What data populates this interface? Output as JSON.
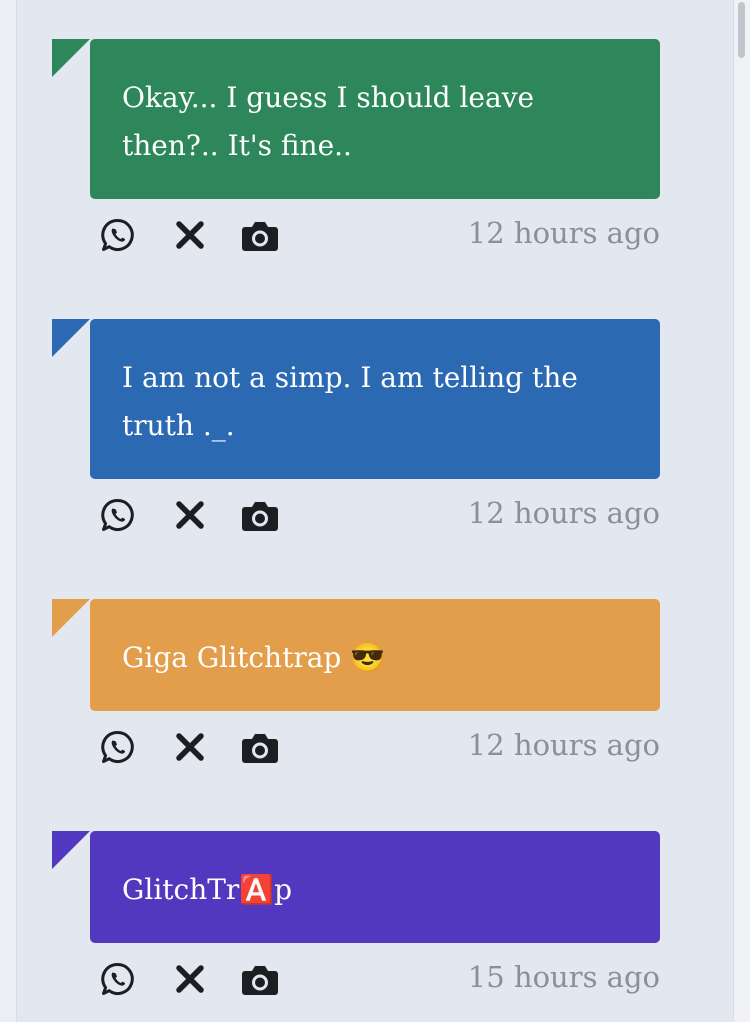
{
  "messages": [
    {
      "text_line1": "Okay... I guess I should leave",
      "text_line2": "then?.. It's fine..",
      "color": "#2e875a",
      "time": "12 hours ago"
    },
    {
      "text_line1": "I am not a simp. I am telling the",
      "text_line2": "truth ._.",
      "color": "#2b69b2",
      "time": "12 hours ago"
    },
    {
      "text_line1": "Giga Glitchtrap 😎",
      "color": "#e39e4c",
      "time": "12 hours ago"
    },
    {
      "text_line1": "GlitchTr🅰️p",
      "color": "#5138bf",
      "time": "15 hours ago"
    }
  ],
  "icons": {
    "share": "whatsapp-icon",
    "close": "close-icon",
    "capture": "camera-icon"
  }
}
